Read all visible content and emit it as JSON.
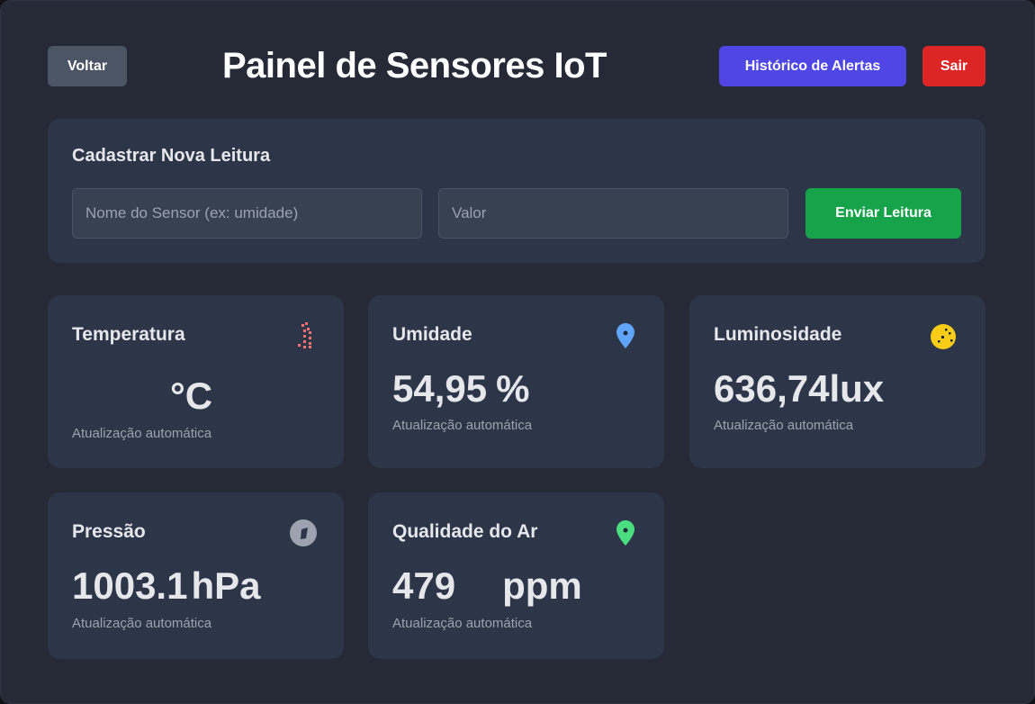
{
  "header": {
    "back_label": "Voltar",
    "title": "Painel de Sensores IoT",
    "alerts_label": "Histórico de Alertas",
    "logout_label": "Sair"
  },
  "form": {
    "title": "Cadastrar Nova Leitura",
    "sensor_placeholder": "Nome do Sensor (ex: umidade)",
    "sensor_value": "",
    "value_placeholder": "Valor",
    "value_value": "",
    "submit_label": "Enviar Leitura"
  },
  "cards": [
    {
      "title": "Temperatura",
      "value": "",
      "unit": "°C",
      "subtitle": "Atualização automática",
      "icon": "thermometer-icon",
      "icon_color": "#f87171"
    },
    {
      "title": "Umidade",
      "value": "54,95",
      "unit": "%",
      "subtitle": "Atualização automática",
      "icon": "droplet-icon",
      "icon_color": "#60a5fa"
    },
    {
      "title": "Luminosidade",
      "value": "636,74",
      "unit": "lux",
      "subtitle": "Atualização automática",
      "icon": "sun-icon",
      "icon_color": "#facc15"
    },
    {
      "title": "Pressão",
      "value": "1003.1",
      "unit": "hPa",
      "subtitle": "Atualização automática",
      "icon": "gauge-icon",
      "icon_color": "#9ca3af"
    },
    {
      "title": "Qualidade do Ar",
      "value": "479",
      "unit": "ppm",
      "subtitle": "Atualização automática",
      "icon": "leaf-icon",
      "icon_color": "#4ade80"
    }
  ]
}
